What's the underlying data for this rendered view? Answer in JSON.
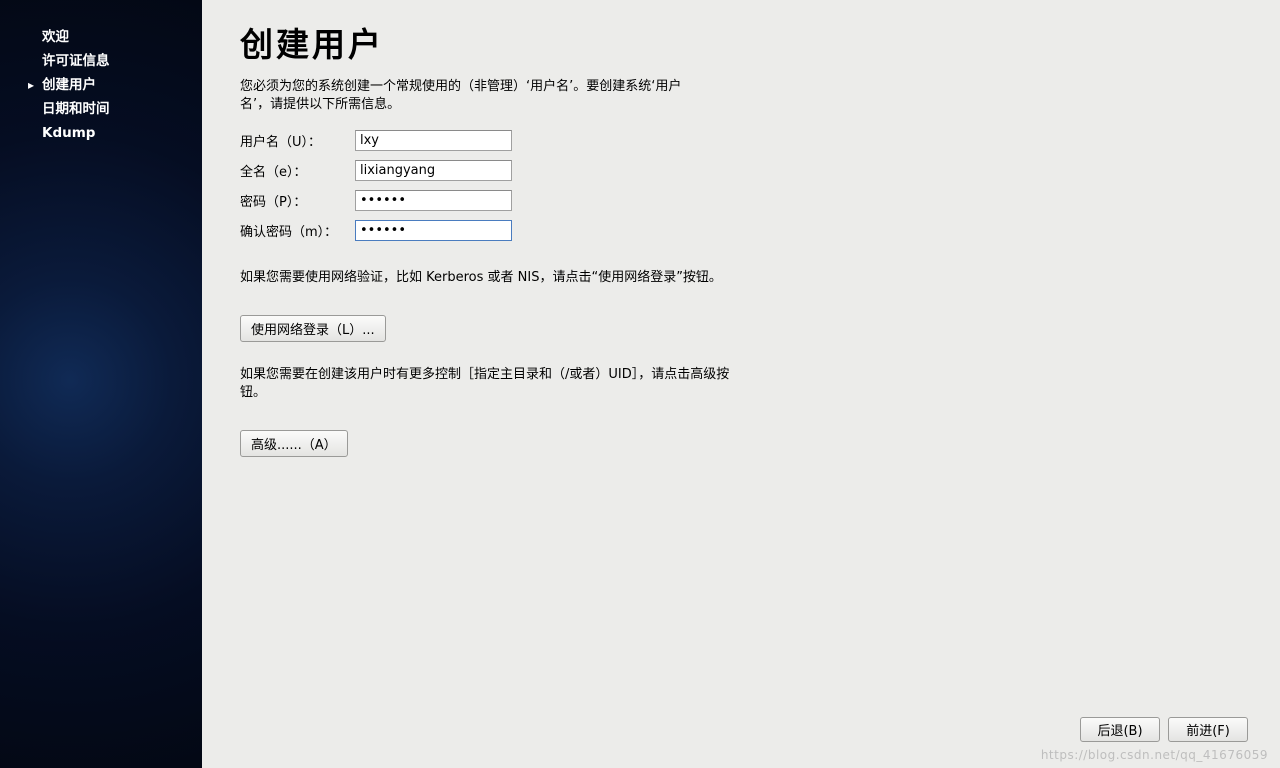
{
  "sidebar": {
    "items": [
      {
        "label": "欢迎"
      },
      {
        "label": "许可证信息"
      },
      {
        "label": "创建用户",
        "active": true
      },
      {
        "label": "日期和时间"
      },
      {
        "label": "Kdump"
      }
    ]
  },
  "main": {
    "title": "创建用户",
    "intro": "您必须为您的系统创建一个常规使用的（非管理）‘用户名’。要创建系统‘用户名’，请提供以下所需信息。",
    "form": {
      "username_label": "用户名（U）：",
      "username_value": "lxy",
      "fullname_label": "全名（e）：",
      "fullname_value": "lixiangyang",
      "password_label": "密码（P）：",
      "password_value": "······",
      "confirm_label": "确认密码（m）：",
      "confirm_value": "······"
    },
    "network_note": "如果您需要使用网络验证，比如 Kerberos 或者 NIS，请点击“使用网络登录”按钮。",
    "network_button": "使用网络登录（L）...",
    "advanced_note": "如果您需要在创建该用户时有更多控制［指定主目录和（/或者）UID］，请点击高级按钮。",
    "advanced_button": "高级......（A）"
  },
  "footer": {
    "back": "后退(B)",
    "forward": "前进(F)"
  },
  "watermark": "https://blog.csdn.net/qq_41676059"
}
